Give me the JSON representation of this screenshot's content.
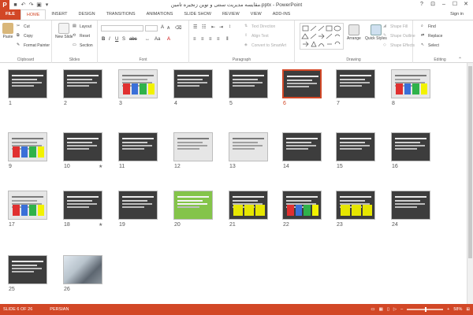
{
  "window": {
    "title": "مقایسه مدیریت سنتی و نوین زنجیره تامین.pptx - PowerPoint",
    "app_badge": "P"
  },
  "tabs": [
    "FILE",
    "HOME",
    "INSERT",
    "DESIGN",
    "TRANSITIONS",
    "ANIMATIONS",
    "SLIDE SHOW",
    "REVIEW",
    "VIEW",
    "ADD-INS"
  ],
  "account": {
    "sign_in": "Sign in"
  },
  "ribbon": {
    "clipboard": {
      "label": "Clipboard",
      "paste": "Paste",
      "cut": "Cut",
      "copy": "Copy",
      "format_painter": "Format Painter"
    },
    "slides": {
      "label": "Slides",
      "new_slide": "New Slide",
      "layout": "Layout",
      "reset": "Reset",
      "section": "Section"
    },
    "font": {
      "label": "Font",
      "bold": "B",
      "italic": "I",
      "underline": "U",
      "strike": "S",
      "abc": "abc"
    },
    "paragraph": {
      "label": "Paragraph",
      "text_direction": "Text Direction",
      "align_text": "Align Text",
      "convert_smartart": "Convert to SmartArt"
    },
    "drawing": {
      "label": "Drawing",
      "arrange": "Arrange",
      "quick_styles": "Quick Styles",
      "shape_fill": "Shape Fill",
      "shape_outline": "Shape Outline",
      "shape_effects": "Shape Effects"
    },
    "editing": {
      "label": "Editing",
      "find": "Find",
      "replace": "Replace",
      "select": "Select"
    }
  },
  "slides": [
    {
      "num": "1",
      "style": "dark"
    },
    {
      "num": "2",
      "style": "dark"
    },
    {
      "num": "3",
      "style": "light-colored"
    },
    {
      "num": "4",
      "style": "dark"
    },
    {
      "num": "5",
      "style": "dark"
    },
    {
      "num": "6",
      "style": "dark",
      "selected": true
    },
    {
      "num": "7",
      "style": "dark"
    },
    {
      "num": "8",
      "style": "light-colored"
    },
    {
      "num": "9",
      "style": "light-colored"
    },
    {
      "num": "10",
      "style": "dark",
      "star": "★"
    },
    {
      "num": "11",
      "style": "dark"
    },
    {
      "num": "12",
      "style": "light"
    },
    {
      "num": "13",
      "style": "light"
    },
    {
      "num": "14",
      "style": "dark"
    },
    {
      "num": "15",
      "style": "dark"
    },
    {
      "num": "16",
      "style": "dark"
    },
    {
      "num": "17",
      "style": "light-colored"
    },
    {
      "num": "18",
      "style": "dark",
      "star": "★"
    },
    {
      "num": "19",
      "style": "dark"
    },
    {
      "num": "20",
      "style": "green"
    },
    {
      "num": "21",
      "style": "dark-yellow"
    },
    {
      "num": "22",
      "style": "dark-colored"
    },
    {
      "num": "23",
      "style": "dark-yellow"
    },
    {
      "num": "24",
      "style": "dark"
    },
    {
      "num": "25",
      "style": "dark"
    },
    {
      "num": "26",
      "style": "photo"
    }
  ],
  "status": {
    "slide_of": "SLIDE 6 OF 26",
    "language": "PERSIAN",
    "zoom": "58%"
  },
  "colors": {
    "accent": "#d24726"
  }
}
